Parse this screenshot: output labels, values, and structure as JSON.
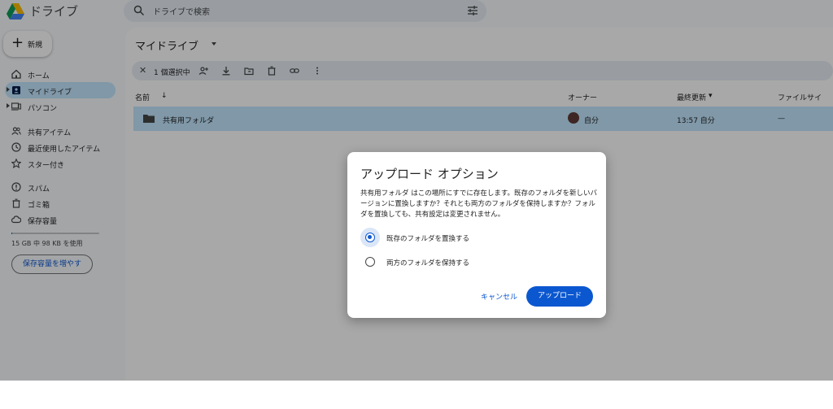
{
  "header": {
    "app_title": "ドライブ",
    "search_placeholder": "ドライブで検索"
  },
  "sidebar": {
    "new_label": "新規",
    "items": [
      {
        "label": "ホーム",
        "icon": "home-icon"
      },
      {
        "label": "マイドライブ",
        "icon": "my-drive-icon",
        "active": true
      },
      {
        "label": "パソコン",
        "icon": "computers-icon"
      },
      {
        "label": "共有アイテム",
        "icon": "shared-icon"
      },
      {
        "label": "最近使用したアイテム",
        "icon": "clock-icon"
      },
      {
        "label": "スター付き",
        "icon": "star-icon"
      },
      {
        "label": "スパム",
        "icon": "spam-icon"
      },
      {
        "label": "ゴミ箱",
        "icon": "trash-icon"
      },
      {
        "label": "保存容量",
        "icon": "cloud-icon"
      }
    ],
    "storage_text": "15 GB 中 98 KB を使用",
    "storage_used_fraction": 0.0,
    "more_storage_label": "保存容量を増やす"
  },
  "main": {
    "title": "マイドライブ",
    "selection": {
      "count_label": "1 個選択中"
    },
    "columns": {
      "name": "名前",
      "owner": "オーナー",
      "modified": "最終更新",
      "size": "ファイルサイ"
    },
    "rows": [
      {
        "name": "共有用フォルダ",
        "owner": "自分",
        "modified": "13:57 自分",
        "size": "—"
      }
    ]
  },
  "dialog": {
    "title": "アップロード オプション",
    "body": "共有用フォルダ はこの場所にすでに存在します。既存のフォルダを新しいバージョンに置換しますか？それとも両方のフォルダを保持しますか？フォルダを置換しても、共有設定は変更されません。",
    "options": [
      {
        "label": "既存のフォルダを置換する",
        "selected": true
      },
      {
        "label": "両方のフォルダを保持する",
        "selected": false
      }
    ],
    "cancel_label": "キャンセル",
    "confirm_label": "アップロード"
  },
  "colors": {
    "accent": "#0b57d0",
    "selection": "#c2e7ff",
    "search_bg": "#e9eef6"
  }
}
